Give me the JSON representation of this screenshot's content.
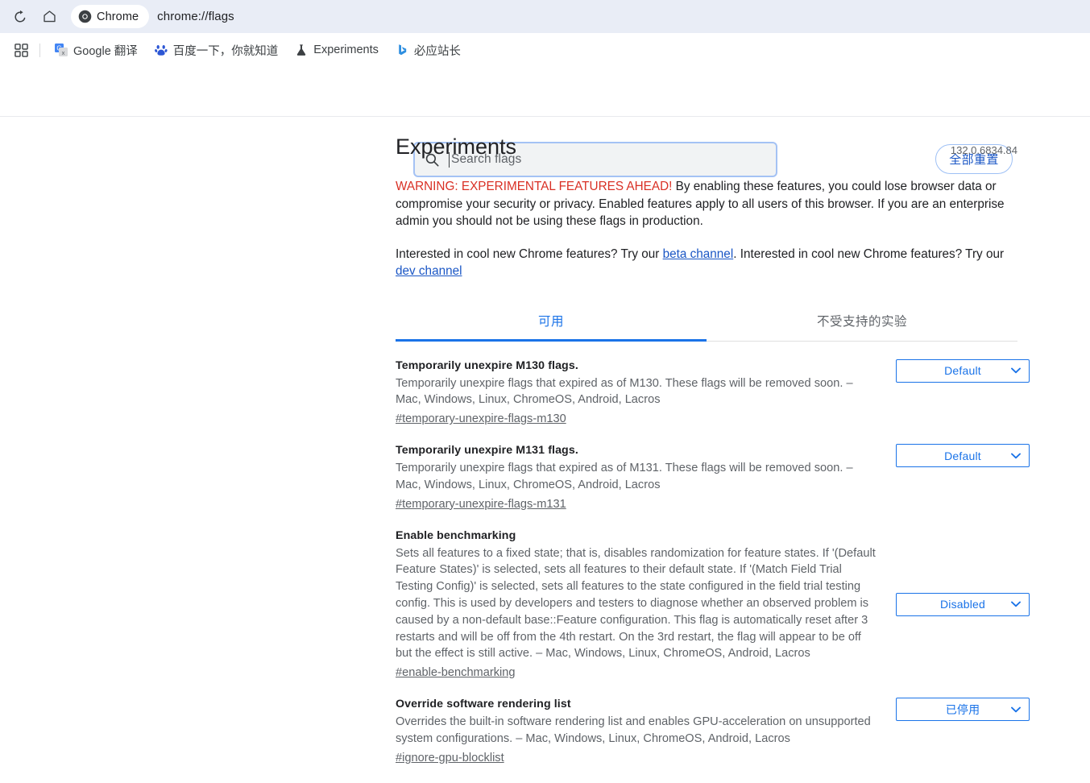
{
  "browser": {
    "reload_icon": "reload-icon",
    "home_icon": "home-icon",
    "chrome_chip_label": "Chrome",
    "url": "chrome://flags",
    "bookmarks": [
      {
        "label": "Google 翻译",
        "icon": "google-translate-icon"
      },
      {
        "label": "百度一下，你就知道",
        "icon": "baidu-paw-icon"
      },
      {
        "label": "Experiments",
        "icon": "flask-icon"
      },
      {
        "label": "必应站长",
        "icon": "bing-icon"
      }
    ],
    "apps_icon": "apps-grid-icon"
  },
  "search": {
    "placeholder": "Search flags",
    "icon": "search-icon"
  },
  "reset": {
    "label": "全部重置"
  },
  "page": {
    "title": "Experiments",
    "version": "132.0.6834.84",
    "warning_strong": "WARNING: EXPERIMENTAL FEATURES AHEAD!",
    "warning_body": " By enabling these features, you could lose browser data or compromise your security or privacy. Enabled features apply to all users of this browser. If you are an enterprise admin you should not be using these flags in production.",
    "channel_text_1": "Interested in cool new Chrome features? Try our ",
    "channel_link_1": "beta channel",
    "channel_text_2": ". Interested in cool new Chrome features? Try our ",
    "channel_link_2": "dev channel"
  },
  "tabs": [
    {
      "label": "可用",
      "active": true
    },
    {
      "label": "不受支持的实验",
      "active": false
    }
  ],
  "flags": [
    {
      "name": "Temporarily unexpire M130 flags.",
      "description": "Temporarily unexpire flags that expired as of M130. These flags will be removed soon. – Mac, Windows, Linux, ChromeOS, Android, Lacros",
      "anchor": "#temporary-unexpire-flags-m130",
      "value": "Default"
    },
    {
      "name": "Temporarily unexpire M131 flags.",
      "description": "Temporarily unexpire flags that expired as of M131. These flags will be removed soon. – Mac, Windows, Linux, ChromeOS, Android, Lacros",
      "anchor": "#temporary-unexpire-flags-m131",
      "value": "Default"
    },
    {
      "name": "Enable benchmarking",
      "description": "Sets all features to a fixed state; that is, disables randomization for feature states. If '(Default Feature States)' is selected, sets all features to their default state. If '(Match Field Trial Testing Config)' is selected, sets all features to the state configured in the field trial testing config. This is used by developers and testers to diagnose whether an observed problem is caused by a non-default base::Feature configuration. This flag is automatically reset after 3 restarts and will be off from the 4th restart. On the 3rd restart, the flag will appear to be off but the effect is still active. – Mac, Windows, Linux, ChromeOS, Android, Lacros",
      "anchor": "#enable-benchmarking",
      "value": "Disabled"
    },
    {
      "name": "Override software rendering list",
      "description": "Overrides the built-in software rendering list and enables GPU-acceleration on unsupported system configurations. – Mac, Windows, Linux, ChromeOS, Android, Lacros",
      "anchor": "#ignore-gpu-blocklist",
      "value": "已停用"
    }
  ],
  "colors": {
    "accent": "#1a73e8",
    "warning": "#d93025",
    "toolbar_bg": "#e9edf6",
    "link": "#1a56c5"
  }
}
